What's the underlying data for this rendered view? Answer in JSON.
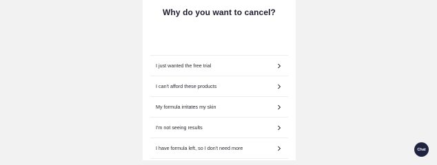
{
  "modal": {
    "title": "Why do you want to cancel?",
    "options": [
      {
        "label": "I just wanted the free trial"
      },
      {
        "label": "I can't afford these products"
      },
      {
        "label": "My formula irritates my skin"
      },
      {
        "label": "I'm not seeing results"
      },
      {
        "label": "I have formula left, so I don't need more"
      }
    ]
  },
  "chat": {
    "label": "Chat"
  },
  "icons": {
    "chevron": "chevron-right-icon"
  },
  "colors": {
    "background": "#f2f2f2",
    "card": "#ffffff",
    "title_text": "#1c1c2c",
    "chat_button": "#1f2340"
  }
}
